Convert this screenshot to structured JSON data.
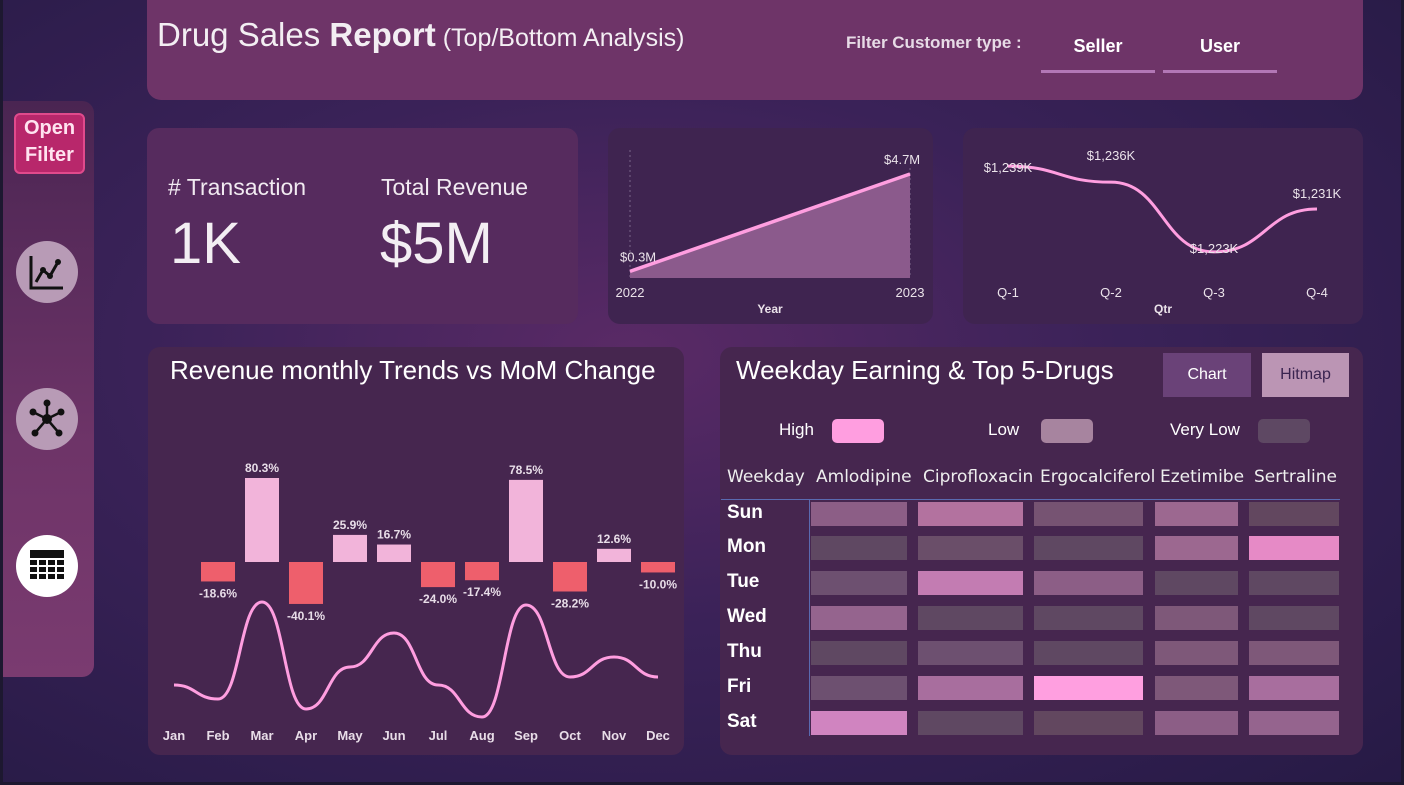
{
  "header": {
    "title_part1": "Drug Sales ",
    "title_bold": "Report",
    "title_sub": " (Top/Bottom Analysis)",
    "filter_label": "Filter Customer type :",
    "filter_options": [
      "Seller",
      "User"
    ]
  },
  "sidebar": {
    "open_filter": "Open Filter",
    "nav_icons": [
      "line-chart-icon",
      "network-icon",
      "calendar-grid-icon"
    ]
  },
  "kpis": {
    "transactions_label": "# Transaction",
    "transactions_value": "1K",
    "revenue_label": "Total Revenue",
    "revenue_value": "$5M"
  },
  "year_chart": {
    "type": "area",
    "x": [
      "2022",
      "2023"
    ],
    "values": [
      0.3,
      4.7
    ],
    "labels": [
      "$0.3M",
      "$4.7M"
    ],
    "xlabel": "Year",
    "color": "#ff9ee0"
  },
  "qtr_chart": {
    "type": "line",
    "x": [
      "Q-1",
      "Q-2",
      "Q-3",
      "Q-4"
    ],
    "values": [
      1239,
      1236,
      1223,
      1231
    ],
    "labels": [
      "$1,239K",
      "$1,236K",
      "$1,223K",
      "$1,231K"
    ],
    "xlabel": "Qtr",
    "color": "#ff9ee0"
  },
  "chart_data": {
    "type": "bar",
    "title": "Revenue monthly Trends vs MoM Change",
    "categories": [
      "Jan",
      "Feb",
      "Mar",
      "Apr",
      "May",
      "Jun",
      "Jul",
      "Aug",
      "Sep",
      "Oct",
      "Nov",
      "Dec"
    ],
    "series": [
      {
        "values": [
          null,
          -18.6,
          80.3,
          -40.1,
          25.9,
          16.7,
          -24.0,
          -17.4,
          78.5,
          -28.2,
          12.6,
          -10.0
        ]
      }
    ],
    "data_labels": [
      "",
      "-18.6%",
      "80.3%",
      "-40.1%",
      "25.9%",
      "16.7%",
      "-24.0%",
      "-17.4%",
      "78.5%",
      "-28.2%",
      "12.6%",
      "-10.0%"
    ],
    "positive_color": "#f2b4da",
    "negative_color": "#ee5f6c",
    "trend_line_color": "#ff9ee0"
  },
  "weekday_panel": {
    "title": "Weekday Earning & Top 5-Drugs",
    "toggle": {
      "chart": "Chart",
      "hitmap": "Hitmap"
    },
    "legend": [
      {
        "label": "High",
        "color": "#ff9ee0"
      },
      {
        "label": "Low",
        "color": "#a7849f"
      },
      {
        "label": "Very Low",
        "color": "#5e4863"
      }
    ],
    "columns": [
      "Weekday",
      "Amlodipine",
      "Ciprofloxacin",
      "Ergocalciferol",
      "Ezetimibe",
      "Sertraline"
    ],
    "rows": [
      {
        "day": "Sun",
        "colors": [
          "#8c5e86",
          "#b3729f",
          "#765372",
          "#9c6890",
          "#62475f"
        ]
      },
      {
        "day": "Mon",
        "colors": [
          "#5f4862",
          "#6a4e69",
          "#5f4862",
          "#9c6890",
          "#e68ac6"
        ]
      },
      {
        "day": "Tue",
        "colors": [
          "#6d5070",
          "#c37cb2",
          "#8c5e86",
          "#5f4862",
          "#5f4862"
        ]
      },
      {
        "day": "Wed",
        "colors": [
          "#95648e",
          "#5f4862",
          "#5f4862",
          "#7e5879",
          "#5f4862"
        ]
      },
      {
        "day": "Thu",
        "colors": [
          "#5f4862",
          "#6d5070",
          "#5f4862",
          "#7e5879",
          "#7e5879"
        ]
      },
      {
        "day": "Fri",
        "colors": [
          "#6d5070",
          "#a86e9e",
          "#ff9fe0",
          "#7e5879",
          "#a86e9e"
        ]
      },
      {
        "day": "Sat",
        "colors": [
          "#d084c0",
          "#5f4862",
          "#62475f",
          "#8c5e86",
          "#95648e"
        ]
      }
    ]
  }
}
